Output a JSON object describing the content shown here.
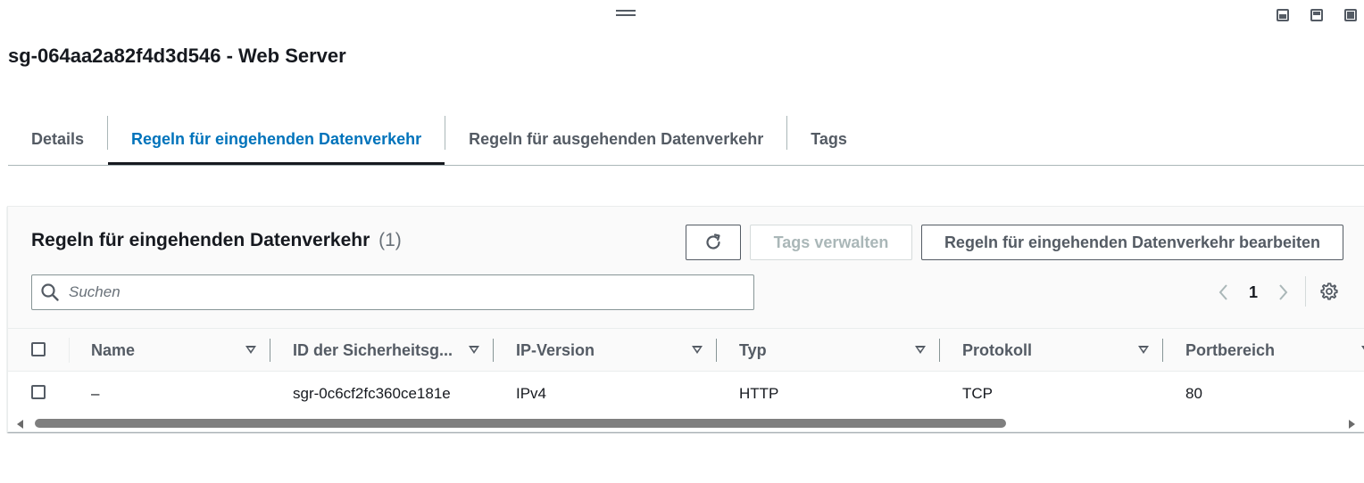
{
  "window": {
    "layout_buttons": [
      "layout-bottom-icon",
      "layout-split-icon",
      "layout-full-icon"
    ]
  },
  "page": {
    "title": "sg-064aa2a82f4d3d546 - Web Server"
  },
  "tabs": [
    {
      "label": "Details",
      "active": false
    },
    {
      "label": "Regeln für eingehenden Datenverkehr",
      "active": true
    },
    {
      "label": "Regeln für ausgehenden Datenverkehr",
      "active": false
    },
    {
      "label": "Tags",
      "active": false
    }
  ],
  "panel": {
    "title": "Regeln für eingehenden Datenverkehr",
    "count": "(1)",
    "refresh_icon": "refresh-icon",
    "tags_button": "Tags verwalten",
    "edit_button": "Regeln für eingehenden Datenverkehr bearbeiten"
  },
  "search": {
    "placeholder": "Suchen",
    "value": ""
  },
  "pagination": {
    "current_page": "1"
  },
  "table": {
    "columns": [
      "Name",
      "ID der Sicherheitsg...",
      "IP-Version",
      "Typ",
      "Protokoll",
      "Portbereich"
    ],
    "rows": [
      {
        "name": "–",
        "rule_id": "sgr-0c6cf2fc360ce181e",
        "ip_version": "IPv4",
        "type": "HTTP",
        "protocol": "TCP",
        "port_range": "80"
      }
    ]
  },
  "colors": {
    "accent": "#0073bb",
    "text": "#16191f",
    "muted": "#545b64"
  }
}
